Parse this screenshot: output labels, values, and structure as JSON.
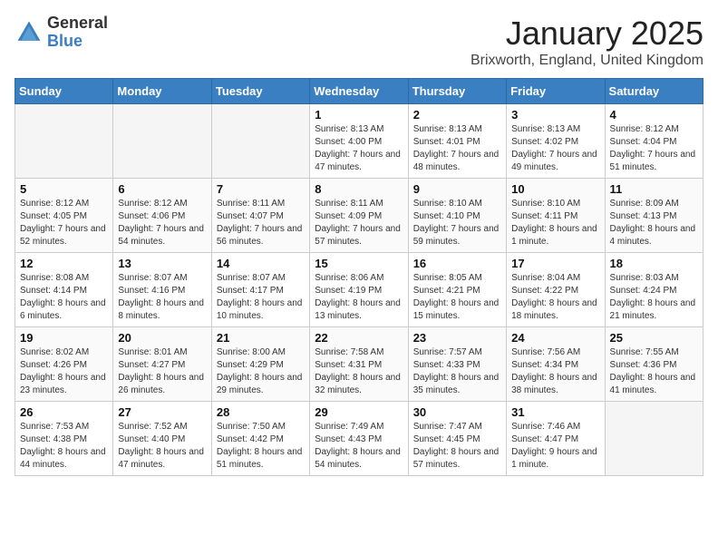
{
  "logo": {
    "general": "General",
    "blue": "Blue"
  },
  "title": {
    "month": "January 2025",
    "location": "Brixworth, England, United Kingdom"
  },
  "weekdays": [
    "Sunday",
    "Monday",
    "Tuesday",
    "Wednesday",
    "Thursday",
    "Friday",
    "Saturday"
  ],
  "weeks": [
    [
      {
        "day": "",
        "info": ""
      },
      {
        "day": "",
        "info": ""
      },
      {
        "day": "",
        "info": ""
      },
      {
        "day": "1",
        "info": "Sunrise: 8:13 AM\nSunset: 4:00 PM\nDaylight: 7 hours and 47 minutes."
      },
      {
        "day": "2",
        "info": "Sunrise: 8:13 AM\nSunset: 4:01 PM\nDaylight: 7 hours and 48 minutes."
      },
      {
        "day": "3",
        "info": "Sunrise: 8:13 AM\nSunset: 4:02 PM\nDaylight: 7 hours and 49 minutes."
      },
      {
        "day": "4",
        "info": "Sunrise: 8:12 AM\nSunset: 4:04 PM\nDaylight: 7 hours and 51 minutes."
      }
    ],
    [
      {
        "day": "5",
        "info": "Sunrise: 8:12 AM\nSunset: 4:05 PM\nDaylight: 7 hours and 52 minutes."
      },
      {
        "day": "6",
        "info": "Sunrise: 8:12 AM\nSunset: 4:06 PM\nDaylight: 7 hours and 54 minutes."
      },
      {
        "day": "7",
        "info": "Sunrise: 8:11 AM\nSunset: 4:07 PM\nDaylight: 7 hours and 56 minutes."
      },
      {
        "day": "8",
        "info": "Sunrise: 8:11 AM\nSunset: 4:09 PM\nDaylight: 7 hours and 57 minutes."
      },
      {
        "day": "9",
        "info": "Sunrise: 8:10 AM\nSunset: 4:10 PM\nDaylight: 7 hours and 59 minutes."
      },
      {
        "day": "10",
        "info": "Sunrise: 8:10 AM\nSunset: 4:11 PM\nDaylight: 8 hours and 1 minute."
      },
      {
        "day": "11",
        "info": "Sunrise: 8:09 AM\nSunset: 4:13 PM\nDaylight: 8 hours and 4 minutes."
      }
    ],
    [
      {
        "day": "12",
        "info": "Sunrise: 8:08 AM\nSunset: 4:14 PM\nDaylight: 8 hours and 6 minutes."
      },
      {
        "day": "13",
        "info": "Sunrise: 8:07 AM\nSunset: 4:16 PM\nDaylight: 8 hours and 8 minutes."
      },
      {
        "day": "14",
        "info": "Sunrise: 8:07 AM\nSunset: 4:17 PM\nDaylight: 8 hours and 10 minutes."
      },
      {
        "day": "15",
        "info": "Sunrise: 8:06 AM\nSunset: 4:19 PM\nDaylight: 8 hours and 13 minutes."
      },
      {
        "day": "16",
        "info": "Sunrise: 8:05 AM\nSunset: 4:21 PM\nDaylight: 8 hours and 15 minutes."
      },
      {
        "day": "17",
        "info": "Sunrise: 8:04 AM\nSunset: 4:22 PM\nDaylight: 8 hours and 18 minutes."
      },
      {
        "day": "18",
        "info": "Sunrise: 8:03 AM\nSunset: 4:24 PM\nDaylight: 8 hours and 21 minutes."
      }
    ],
    [
      {
        "day": "19",
        "info": "Sunrise: 8:02 AM\nSunset: 4:26 PM\nDaylight: 8 hours and 23 minutes."
      },
      {
        "day": "20",
        "info": "Sunrise: 8:01 AM\nSunset: 4:27 PM\nDaylight: 8 hours and 26 minutes."
      },
      {
        "day": "21",
        "info": "Sunrise: 8:00 AM\nSunset: 4:29 PM\nDaylight: 8 hours and 29 minutes."
      },
      {
        "day": "22",
        "info": "Sunrise: 7:58 AM\nSunset: 4:31 PM\nDaylight: 8 hours and 32 minutes."
      },
      {
        "day": "23",
        "info": "Sunrise: 7:57 AM\nSunset: 4:33 PM\nDaylight: 8 hours and 35 minutes."
      },
      {
        "day": "24",
        "info": "Sunrise: 7:56 AM\nSunset: 4:34 PM\nDaylight: 8 hours and 38 minutes."
      },
      {
        "day": "25",
        "info": "Sunrise: 7:55 AM\nSunset: 4:36 PM\nDaylight: 8 hours and 41 minutes."
      }
    ],
    [
      {
        "day": "26",
        "info": "Sunrise: 7:53 AM\nSunset: 4:38 PM\nDaylight: 8 hours and 44 minutes."
      },
      {
        "day": "27",
        "info": "Sunrise: 7:52 AM\nSunset: 4:40 PM\nDaylight: 8 hours and 47 minutes."
      },
      {
        "day": "28",
        "info": "Sunrise: 7:50 AM\nSunset: 4:42 PM\nDaylight: 8 hours and 51 minutes."
      },
      {
        "day": "29",
        "info": "Sunrise: 7:49 AM\nSunset: 4:43 PM\nDaylight: 8 hours and 54 minutes."
      },
      {
        "day": "30",
        "info": "Sunrise: 7:47 AM\nSunset: 4:45 PM\nDaylight: 8 hours and 57 minutes."
      },
      {
        "day": "31",
        "info": "Sunrise: 7:46 AM\nSunset: 4:47 PM\nDaylight: 9 hours and 1 minute."
      },
      {
        "day": "",
        "info": ""
      }
    ]
  ]
}
